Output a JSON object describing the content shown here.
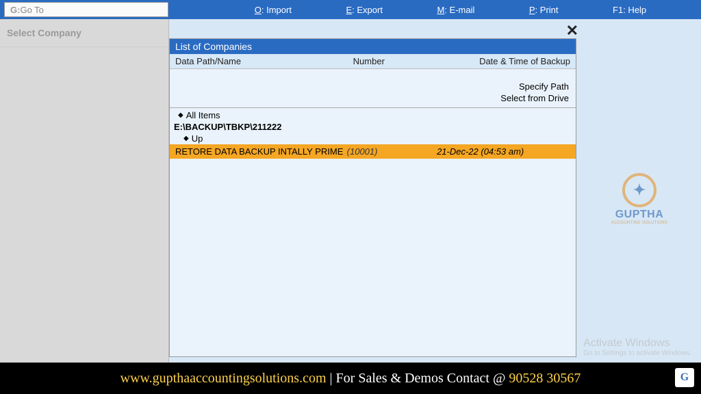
{
  "topbar": {
    "goto_key": "G:",
    "goto_label": " Go To",
    "menu": [
      {
        "key": "O",
        "label": ": Import"
      },
      {
        "key": "E",
        "label": ": Export"
      },
      {
        "key": "M",
        "label": ": E-mail"
      },
      {
        "key": "P",
        "label": ": Print"
      },
      {
        "key": "F1",
        "label": ": Help"
      }
    ]
  },
  "left": {
    "select_company": "Select Company"
  },
  "list": {
    "title": "List of Companies",
    "col_name": "Data Path/Name",
    "col_number": "Number",
    "col_date": "Date & Time of Backup",
    "specify_path": "Specify Path",
    "select_drive": "Select from Drive",
    "all_items": "All Items",
    "path": "E:\\BACKUP\\TBKP\\211222",
    "up": "Up",
    "row": {
      "name": "RETORE DATA BACKUP INTALLY PRIME",
      "number": "(10001)",
      "date": "21-Dec-22 (04:53 am)"
    }
  },
  "logo": {
    "brand": "GUPTHA",
    "sub": "ACCOUNTING SOLUTIONS"
  },
  "activate": {
    "t1": "Activate Windows",
    "t2": "Go to Settings to activate Windows."
  },
  "footer": {
    "site": "www.gupthaaccountingsolutions.com",
    "sep": " | ",
    "msg": "For Sales & Demos Contact @ ",
    "phone": "90528 30567"
  }
}
